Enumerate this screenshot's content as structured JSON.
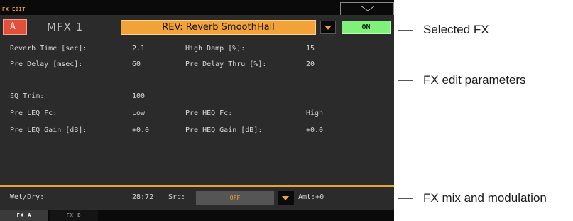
{
  "window": {
    "title": "FX EDIT"
  },
  "header": {
    "slot": "A",
    "mfx": "MFX 1",
    "fx_name": "REV: Reverb SmoothHall",
    "on_label": "ON"
  },
  "params": {
    "reverb_time_label": "Reverb Time [sec]:",
    "reverb_time_value": "2.1",
    "high_damp_label": "High Damp [%]:",
    "high_damp_value": "15",
    "pre_delay_label": "Pre Delay [msec]:",
    "pre_delay_value": "60",
    "pre_delay_thru_label": "Pre Delay Thru [%]:",
    "pre_delay_thru_value": "20",
    "eq_trim_label": "EQ Trim:",
    "eq_trim_value": "100",
    "pre_leq_fc_label": "Pre LEQ Fc:",
    "pre_leq_fc_value": "Low",
    "pre_heq_fc_label": "Pre HEQ Fc:",
    "pre_heq_fc_value": "High",
    "pre_leq_gain_label": "Pre LEQ Gain [dB]:",
    "pre_leq_gain_value": "+0.0",
    "pre_heq_gain_label": "Pre HEQ Gain [dB]:",
    "pre_heq_gain_value": "+0.0"
  },
  "mix": {
    "wet_dry_label": "Wet/Dry:",
    "wet_dry_value": "28:72",
    "src_label": "Src:",
    "src_value": "OFF",
    "amt_label": "Amt:+0"
  },
  "tabs": [
    {
      "label": "FX A"
    },
    {
      "label": "FX B"
    }
  ],
  "callouts": {
    "selected_fx": "Selected FX",
    "fx_edit_parameters": "FX edit parameters",
    "fx_mix_modulation": "FX mix and modulation"
  },
  "colors": {
    "accent": "#f1a33a",
    "on": "#7ff07a",
    "slot": "#e0503b",
    "panel": "#2b2b2b"
  },
  "icons": {
    "collapse": "chevron-down-icon",
    "dropdown": "triangle-down-icon"
  }
}
